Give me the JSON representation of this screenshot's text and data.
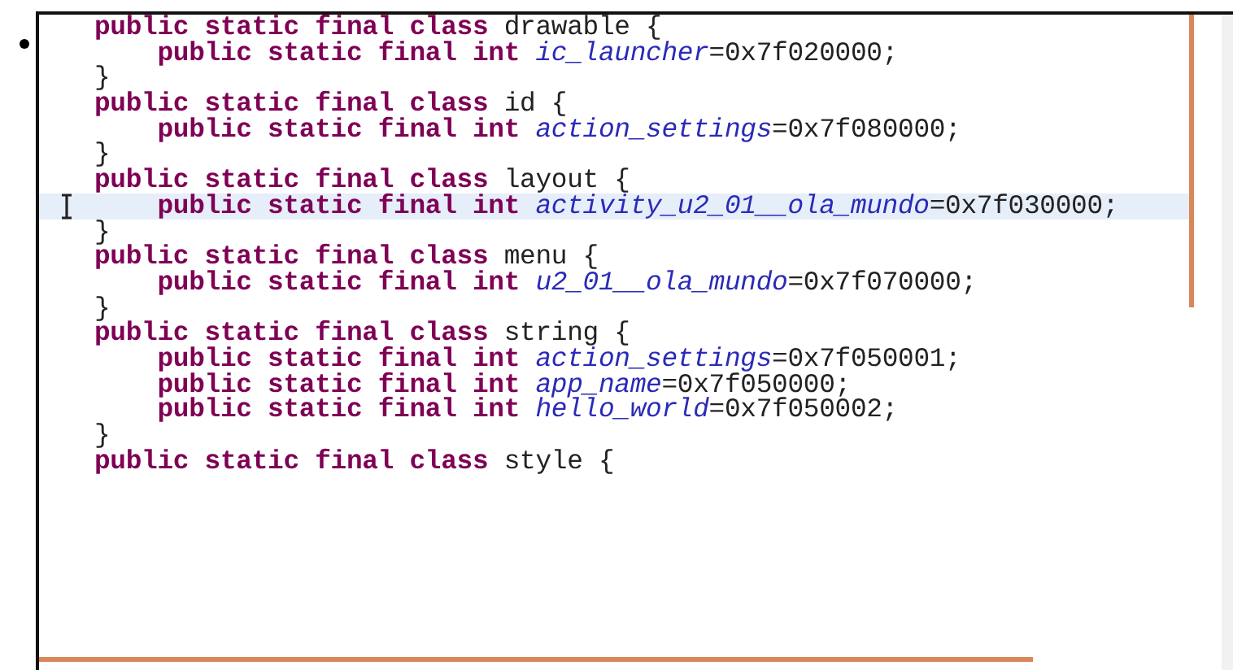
{
  "code_editor": {
    "classes": [
      {
        "keywords": "public static final class",
        "name": "drawable",
        "open": "{",
        "members": [
          {
            "keywords": "public static final int",
            "field": "ic_launcher",
            "value": "=0x7f020000;",
            "current": false
          }
        ],
        "close": "}"
      },
      {
        "keywords": "public static final class",
        "name": "id",
        "open": "{",
        "members": [
          {
            "keywords": "public static final int",
            "field": "action_settings",
            "value": "=0x7f080000;",
            "current": false
          }
        ],
        "close": "}"
      },
      {
        "keywords": "public static final class",
        "name": "layout",
        "open": "{",
        "members": [
          {
            "keywords": "public static final int",
            "field": "activity_u2_01__ola_mundo",
            "value": "=0x7f030000;",
            "current": true
          }
        ],
        "close": "}"
      },
      {
        "keywords": "public static final class",
        "name": "menu",
        "open": "{",
        "members": [
          {
            "keywords": "public static final int",
            "field": "u2_01__ola_mundo",
            "value": "=0x7f070000;",
            "current": false
          }
        ],
        "close": "}"
      },
      {
        "keywords": "public static final class",
        "name": "string",
        "open": "{",
        "members": [
          {
            "keywords": "public static final int",
            "field": "action_settings",
            "value": "=0x7f050001;",
            "current": false
          },
          {
            "keywords": "public static final int",
            "field": "app_name",
            "value": "=0x7f050000;",
            "current": false
          },
          {
            "keywords": "public static final int",
            "field": "hello_world",
            "value": "=0x7f050002;",
            "current": false
          }
        ],
        "close": "}"
      },
      {
        "keywords": "public static final class",
        "name": "style",
        "open": "{"
      }
    ]
  }
}
